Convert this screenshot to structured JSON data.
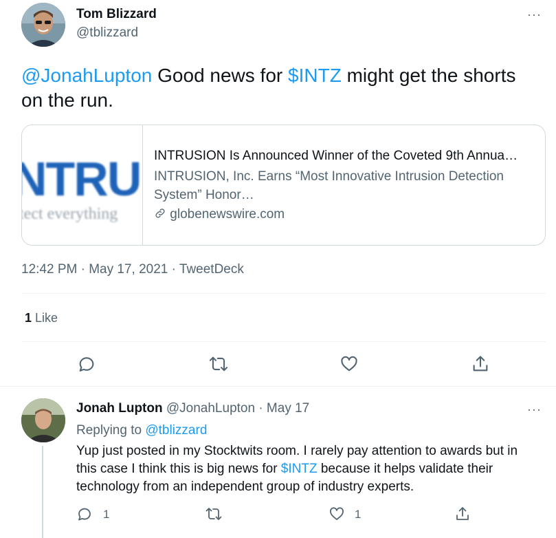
{
  "tweet": {
    "author_name": "Tom Blizzard",
    "author_handle": "@tblizzard",
    "more": "···",
    "mention": "@JonahLupton",
    "text_part1": " Good news for ",
    "cashtag": "$INTZ",
    "text_part2": "  might get the shorts on the run.",
    "timestamp": "12:42 PM · May 17, 2021 · TweetDeck"
  },
  "card": {
    "logo_text": "NTRU",
    "logo_tagline": "tect everything",
    "title": "INTRUSION Is Announced Winner of the Coveted 9th Annua…",
    "description": "INTRUSION, Inc. Earns “Most Innovative Intrusion Detection System” Honor…",
    "domain": "globenewswire.com"
  },
  "stats": {
    "likes_count": "1",
    "likes_label": " Like"
  },
  "reply": {
    "author_name": "Jonah Lupton",
    "author_handle": "@JonahLupton",
    "date": "· May 17",
    "more": "···",
    "replying_prefix": "Replying to ",
    "replying_handle": "@tblizzard",
    "text_part1": "Yup just posted in my Stocktwits room. I rarely pay attention to awards but in this case I think this is big news for ",
    "cashtag": "$INTZ",
    "text_part2": " because it helps validate their technology from an independent group of industry experts.",
    "reply_count": "1",
    "like_count": "1"
  },
  "colors": {
    "link": "#1d9bf0",
    "muted": "#536471",
    "text": "#0f1419",
    "divider": "#eff3f4",
    "logo_blue": "#1e63b8"
  }
}
